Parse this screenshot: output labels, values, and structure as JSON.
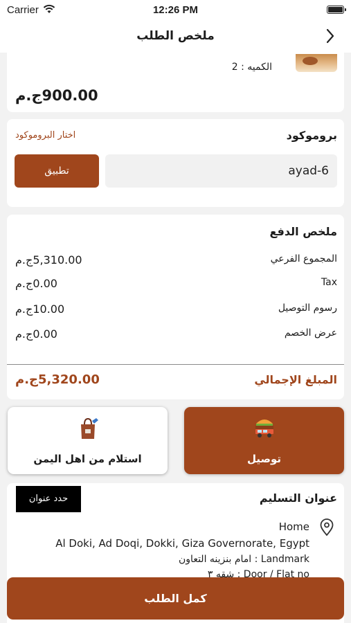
{
  "status_bar": {
    "carrier": "Carrier",
    "time": "12:26 PM"
  },
  "nav": {
    "title": "ملخص الطلب",
    "back_icon": "chevron-right-icon"
  },
  "item": {
    "quantity": "الكميه : 2",
    "price": "900.00ج.م"
  },
  "promo": {
    "title": "بروموكود",
    "choose_link": "اختار البروموكود",
    "code_value": "ayad-6",
    "apply_label": "تطبيق"
  },
  "summary": {
    "title": "ملخص الدفع",
    "rows": [
      {
        "label": "المجموع الفرعي",
        "value": "5,310.00ج.م"
      },
      {
        "label": "Tax",
        "value": "0.00ج.م"
      },
      {
        "label": "رسوم التوصيل",
        "value": "10.00ج.م"
      },
      {
        "label": "عرض الخصم",
        "value": "0.00ج.م"
      }
    ],
    "total_label": "المبلغ الإجمالي",
    "total_value": "5,320.00ج.م"
  },
  "order_type": {
    "delivery_label": "توصيل",
    "pickup_label": "استلام من اهل اليمن"
  },
  "address": {
    "title": "عنوان التسليم",
    "choose_label": "حدد عنوان",
    "name": "Home",
    "full": "Al Doki, Ad Doqi, Dokki, Giza Governorate, Egypt",
    "landmark": "امام بنزينه التعاون : Landmark",
    "flat": "شقه ٣ : Door / Flat no"
  },
  "footer": {
    "complete_label": "كمل الطلب"
  },
  "colors": {
    "accent": "#a0461c",
    "background": "#f2f2f2"
  }
}
